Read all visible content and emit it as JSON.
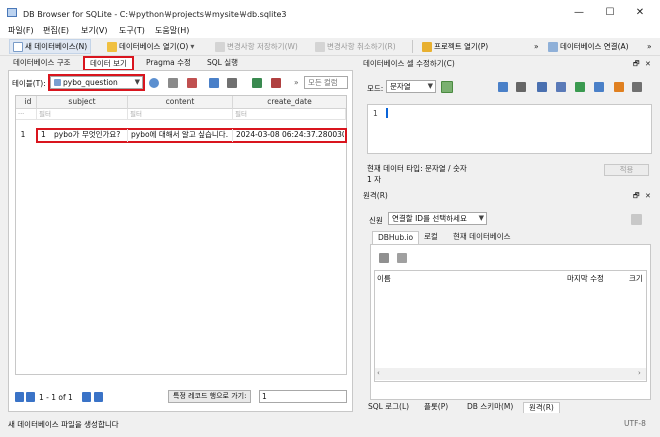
{
  "window": {
    "title": "DB Browser for SQLite - C:￦python￦projects￦mysite￦db.sqlite3",
    "minimize": "—",
    "maximize": "☐",
    "close": "✕"
  },
  "menubar": {
    "items": [
      "파일(F)",
      "편집(E)",
      "보기(V)",
      "도구(T)",
      "도움말(H)"
    ]
  },
  "toolbar": {
    "new_db": "새 데이터베이스(N)",
    "open_db": "데이터베이스 열기(O)",
    "write_changes": "변경사항 저장하기(W)",
    "revert_changes": "변경사항 취소하기(R)",
    "open_project": "프로젝트 열기(P)",
    "attach_db": "데이터베이스 연결(A)",
    "overflow": "»"
  },
  "tabs": {
    "items": [
      "데이터베이스 구조",
      "데이터 보기",
      "Pragma 수정",
      "SQL 실행"
    ],
    "active_index": 1
  },
  "browse": {
    "table_label": "테이블(T):",
    "table_value": "pybo_question",
    "filter_placeholder": "모든 컬럼",
    "overflow": "»",
    "columns": [
      "id",
      "subject",
      "content",
      "create_date"
    ],
    "filter_text": "필터",
    "rows": [
      {
        "rownum": "1",
        "cells": [
          "1",
          "pybo가 무엇인가요?",
          "pybo에 대해서 알고 싶습니다.",
          "2024-03-08 06:24:37.280030"
        ]
      }
    ],
    "nav_range": "1 - 1 of 1",
    "goto_button": "특정 레코드 행으로 가기:",
    "goto_value": "1"
  },
  "edit_cell": {
    "header": "데이터베이스 셀 수정하기(C)",
    "mode_label": "모드:",
    "mode_value": "문자열",
    "line_number": "1",
    "type_info": "현재 데이터 타입: 문자열 / 숫자",
    "size_info": "1 자",
    "apply_button": "적용"
  },
  "remote": {
    "header": "원격(R)",
    "identity_label": "신원",
    "identity_value": "연결할 ID를 선택하세요",
    "tabs": [
      "DBHub.io",
      "로컬",
      "현재 데이터베이스"
    ],
    "columns": [
      "이름",
      "마지막 수정",
      "크기"
    ]
  },
  "bottom_tabs": {
    "items": [
      "SQL 로그(L)",
      "플롯(P)",
      "DB 스키마(M)",
      "원격(R)"
    ],
    "active_index": 3
  },
  "status": {
    "message": "새 데이터베이스 파일을 생성합니다",
    "encoding": "UTF-8"
  },
  "colors": {
    "highlight": "#d9151e",
    "nav_blue": "#3a73c7",
    "selection": "#0a64d8"
  }
}
